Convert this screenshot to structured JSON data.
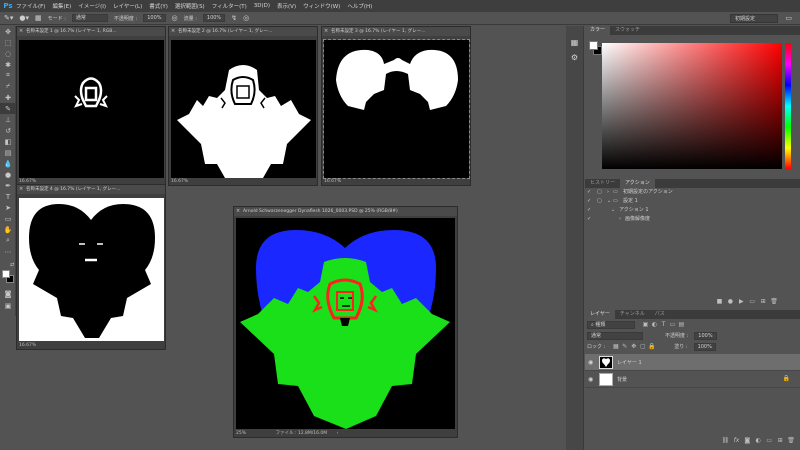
{
  "app": {
    "logo": "Ps",
    "menu": [
      "ファイル(F)",
      "編集(E)",
      "イメージ(I)",
      "レイヤー(L)",
      "書式(Y)",
      "選択範囲(S)",
      "フィルター(T)",
      "3D(D)",
      "表示(V)",
      "ウィンドウ(W)",
      "ヘルプ(H)"
    ]
  },
  "options": {
    "mode_label": "モード :",
    "mode_value": "通常",
    "opacity_label": "不透明度 :",
    "opacity_value": "100%",
    "flow_label": "流量 :",
    "flow_value": "100%",
    "workspace": "初期設定"
  },
  "documents": [
    {
      "title": "名称未設定 1 @ 16.7% (レイヤー 1, RGB...",
      "zoom": "16.67%"
    },
    {
      "title": "名称未設定 2 @ 16.7% (レイヤー 1, グレー...",
      "zoom": "16.67%"
    },
    {
      "title": "名称未設定 3 @ 16.7% (レイヤー 1, グレー...",
      "zoom": "16.67%"
    },
    {
      "title": "名称未設定 4 @ 16.7% (レイヤー 1, グレー...",
      "zoom": "16.67%"
    },
    {
      "title": "Arnold Schwarzenegger Dynaflesh 1026_0003.PSD @ 25% (RGB/8#)",
      "zoom": "25%",
      "file_info": "ファイル : 12.8M/16.0M"
    }
  ],
  "color_panel": {
    "tabs": [
      "カラー",
      "スウォッチ"
    ],
    "fg": "#ffffff",
    "bg": "#000000"
  },
  "history_panel": {
    "tabs": [
      "ヒストリー",
      "アクション"
    ],
    "rows": [
      "初期設定のアクション",
      "設定 1",
      "アクション 1",
      "画像解像度"
    ]
  },
  "layers_panel": {
    "tabs": [
      "レイヤー",
      "チャンネル",
      "パス"
    ],
    "kind": "種類",
    "blend_mode": "通常",
    "opacity_label": "不透明度 :",
    "opacity_value": "100%",
    "lock_label": "ロック :",
    "fill_label": "塗り :",
    "fill_value": "100%",
    "layers": [
      {
        "name": "レイヤー 1",
        "selected": true
      },
      {
        "name": "背景",
        "selected": false
      }
    ]
  }
}
